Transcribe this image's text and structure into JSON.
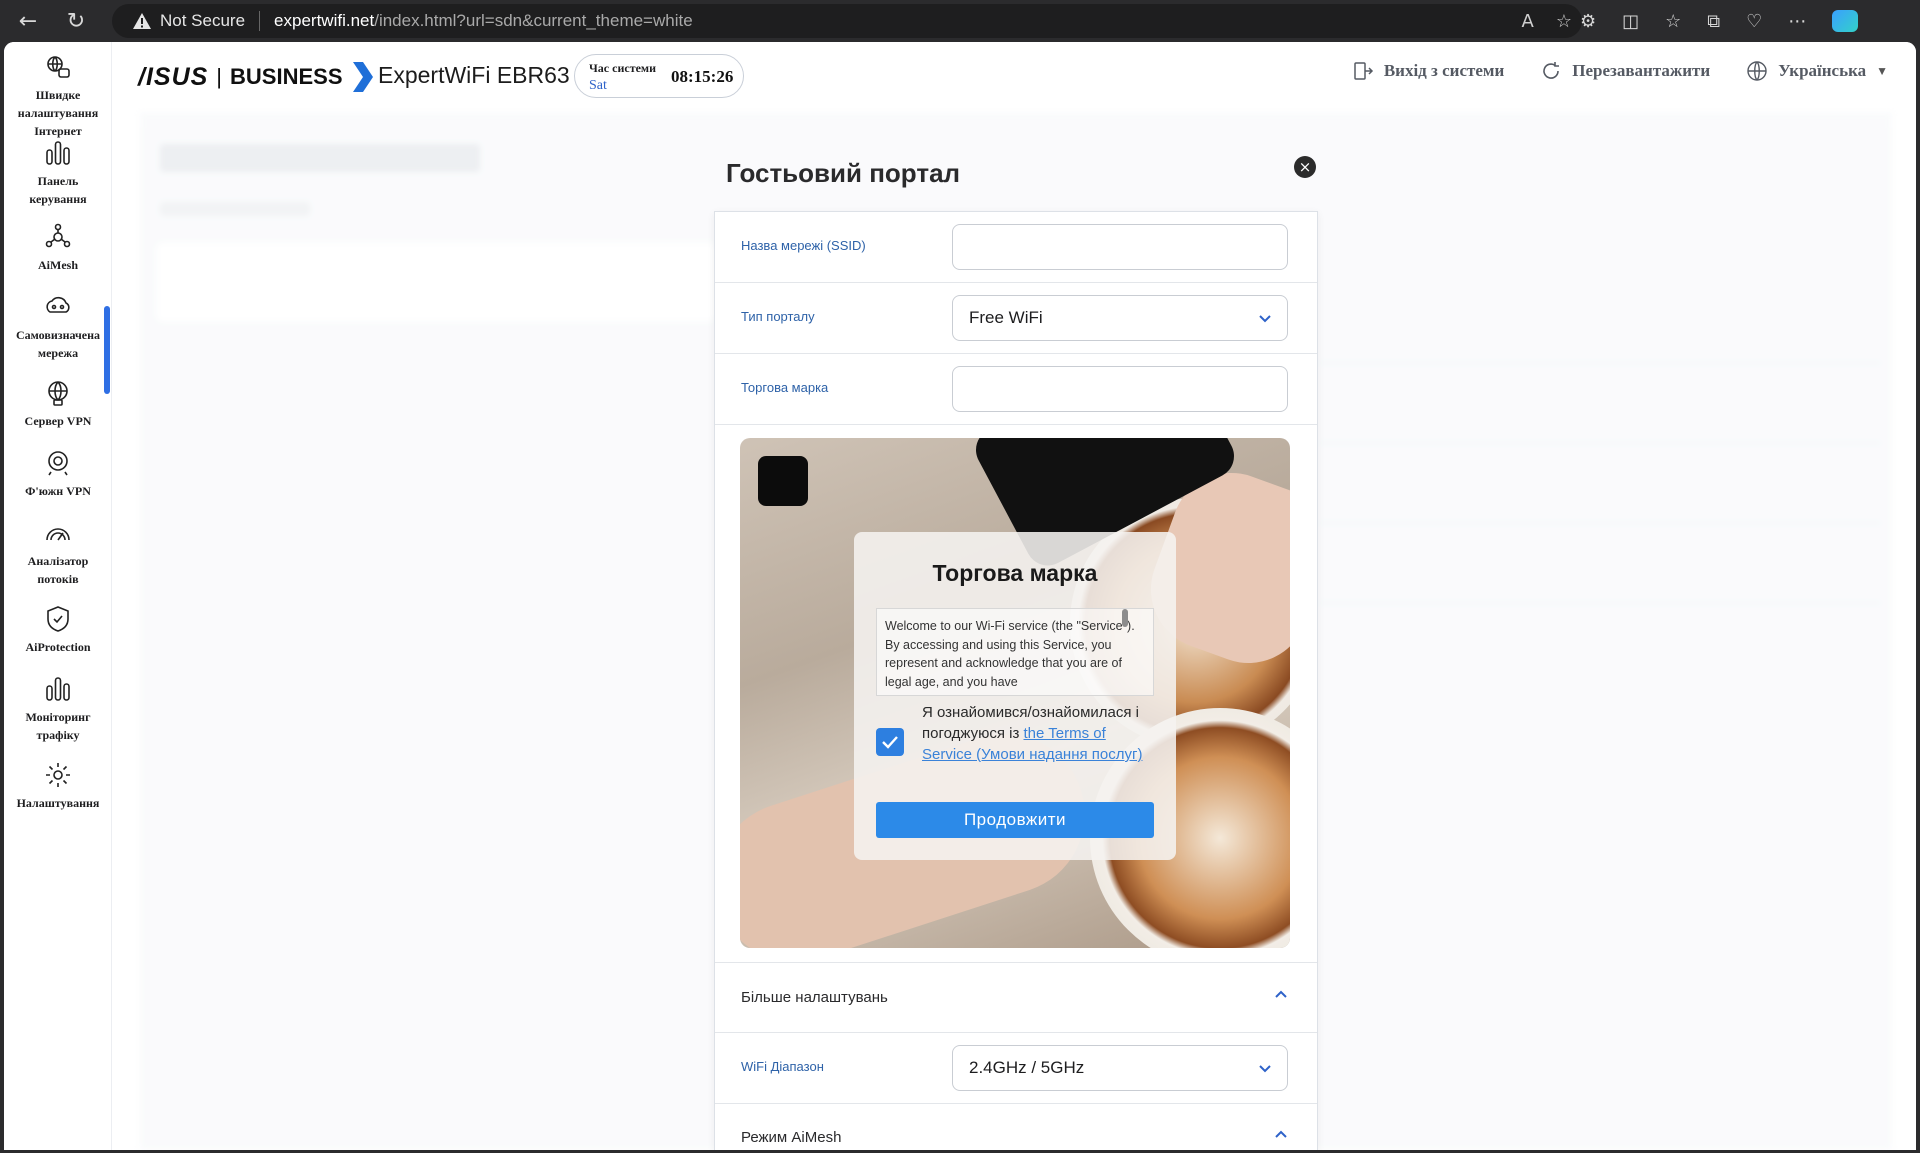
{
  "browser": {
    "security_label": "Not Secure",
    "url_domain": "expertwifi.net",
    "url_path": "/index.html?url=sdn&current_theme=white"
  },
  "sidebar": {
    "items": [
      {
        "label": "Швидке налаштування Інтернет",
        "icon": "quick-setup-icon"
      },
      {
        "label": "Панель керування",
        "icon": "dashboard-icon"
      },
      {
        "label": "AiMesh",
        "icon": "aimesh-icon"
      },
      {
        "label": "Самовизначена мережа",
        "icon": "custom-network-icon"
      },
      {
        "label": "Сервер VPN",
        "icon": "vpn-server-icon"
      },
      {
        "label": "Ф'южн VPN",
        "icon": "fusion-vpn-icon"
      },
      {
        "label": "Аналізатор потоків",
        "icon": "flow-analyzer-icon"
      },
      {
        "label": "AiProtection",
        "icon": "shield-icon"
      },
      {
        "label": "Моніторинг трафіку",
        "icon": "traffic-monitor-icon"
      },
      {
        "label": "Налаштування",
        "icon": "settings-icon"
      }
    ]
  },
  "header": {
    "brand_asus": "/ISUS",
    "brand_sep": "|",
    "brand_business": "BUSINESS",
    "model": "ExpertWiFi EBR63",
    "clock_label": "Час системи",
    "clock_day": "Sat",
    "clock_time": "08:15:26",
    "logout": "Вихід з системи",
    "reboot": "Перезавантажити",
    "language": "Українська"
  },
  "modal": {
    "title": "Гостьовий портал",
    "close": "×",
    "ssid_label": "Назва мережі (SSID)",
    "ssid_value": "",
    "portal_type_label": "Тип порталу",
    "portal_type_value": "Free WiFi",
    "brand_label": "Торгова марка",
    "brand_value": "",
    "more_settings": "Більше налаштувань",
    "wifi_band_label": "WiFi Діапазон",
    "wifi_band_value": "2.4GHz / 5GHz",
    "aimesh_mode": "Режим AiMesh"
  },
  "preview": {
    "title": "Торгова марка",
    "terms_text": "Welcome to our Wi-Fi service (the \"Service\"). By accessing and using this Service, you represent and acknowledge that you are of legal age, and you have",
    "agree_prefix": "Я ознайомився/ознайомилася і погоджуюся із ",
    "agree_link": "the Terms of Service (Умови надання послуг)",
    "continue_button": "Продовжити",
    "checked": true
  },
  "colors": {
    "accent": "#2f6fe4",
    "button": "#2c8ae8",
    "label_blue": "#2e62a8"
  }
}
